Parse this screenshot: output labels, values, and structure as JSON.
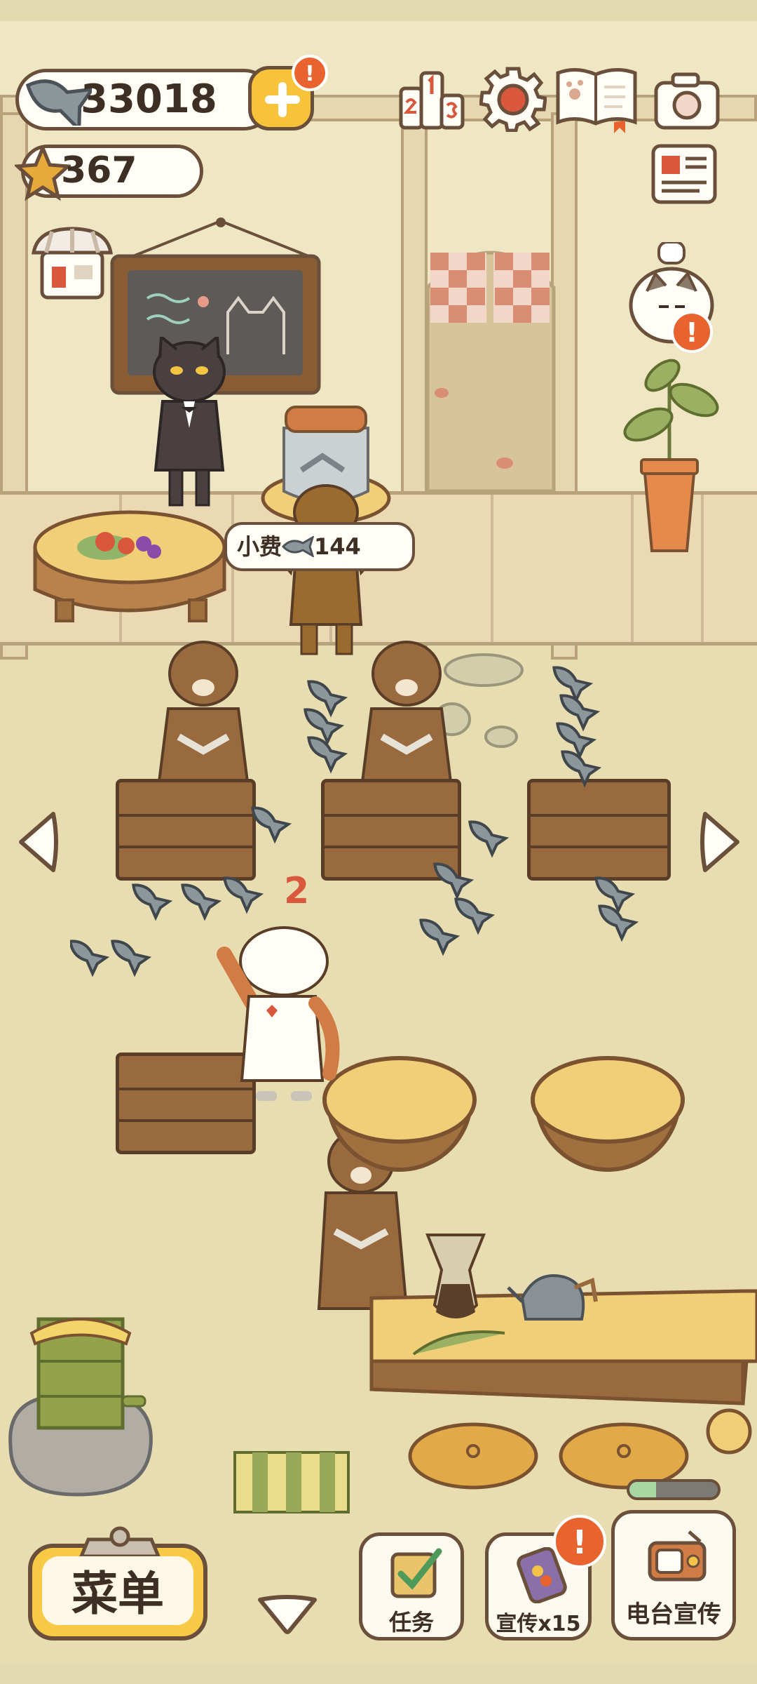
{
  "hud": {
    "fish_count": "33018",
    "star_count": "367",
    "alert_mark": "!"
  },
  "scene": {
    "tip_label": "小费",
    "tip_amount": "144",
    "cat_order_number": "2"
  },
  "bottom_bar": {
    "menu_label": "菜单",
    "tasks_label": "任务",
    "promote_label": "宣传x15",
    "radio_label": "电台宣传",
    "radio_progress": 0.3
  },
  "colors": {
    "accent_yellow": "#f7c33a",
    "alert_orange": "#e8632d",
    "outline_brown": "#6a4f3a",
    "progress_green": "#a9d7a2"
  },
  "icons": [
    "fish-icon",
    "star-icon",
    "plus-icon",
    "ranking-icon",
    "gear-icon",
    "journal-icon",
    "camera-icon",
    "newspaper-icon",
    "shop-icon",
    "arrow-left-icon",
    "arrow-right-icon",
    "chevron-down-icon",
    "checklist-icon",
    "phone-icon",
    "radio-icon"
  ]
}
